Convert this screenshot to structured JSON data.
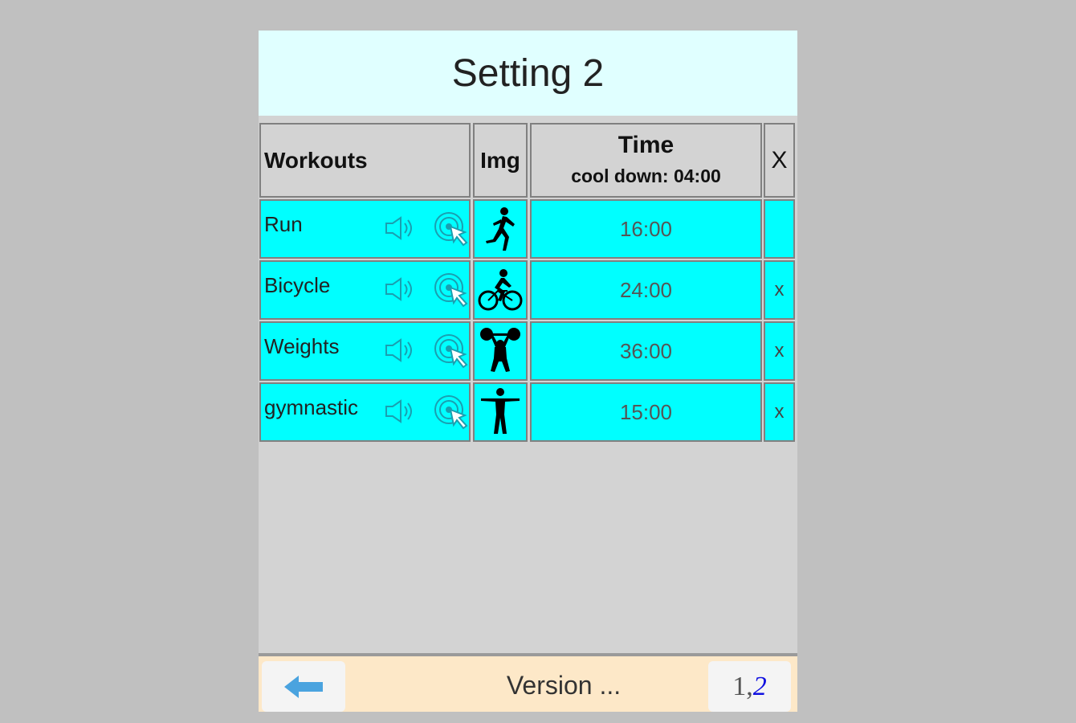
{
  "title": "Setting 2",
  "table": {
    "headers": {
      "workouts": "Workouts",
      "img": "Img",
      "time": "Time",
      "time_sub": "cool down: 04:00",
      "delete": "X"
    },
    "rows": [
      {
        "name": "Run",
        "image_icon": "runner-icon",
        "time": "16:00",
        "delete": ""
      },
      {
        "name": "Bicycle",
        "image_icon": "cyclist-icon",
        "time": "24:00",
        "delete": "x"
      },
      {
        "name": "Weights",
        "image_icon": "weightlifter-icon",
        "time": "36:00",
        "delete": "x"
      },
      {
        "name": "gymnastic",
        "image_icon": "gymnast-icon",
        "time": "15:00",
        "delete": "x"
      }
    ]
  },
  "footer": {
    "version": "Version ...",
    "page_current": "1,",
    "page_next": "2"
  },
  "colors": {
    "background": "#c0c0c0",
    "title_bg": "#e0ffff",
    "row_bg": "#00ffff",
    "header_bg": "#d3d3d3",
    "footer_bg": "#fde8c8",
    "back_arrow": "#4aa3df",
    "page_link": "#1010e0"
  }
}
